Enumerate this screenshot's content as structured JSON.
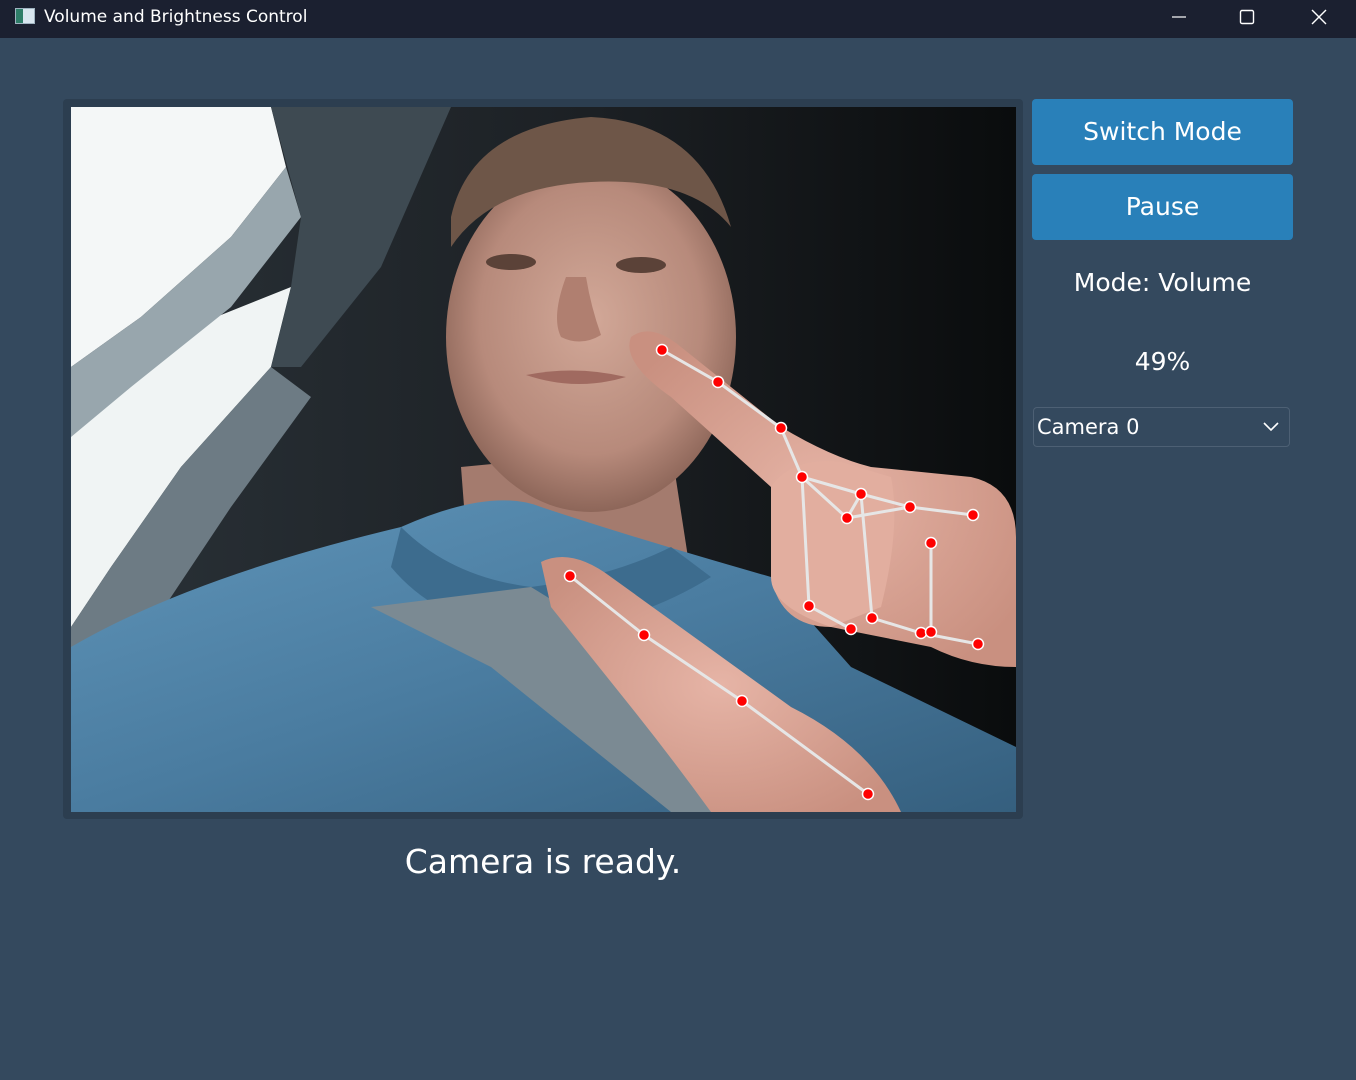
{
  "window": {
    "title": "Volume and Brightness Control",
    "controls": {
      "minimize": "minimize-icon",
      "maximize": "maximize-icon",
      "close": "close-icon"
    }
  },
  "controls": {
    "switch_mode_label": "Switch Mode",
    "pause_label": "Pause",
    "mode_text": "Mode: Volume",
    "value_text": "49%",
    "camera_select": {
      "selected": "Camera 0",
      "icon": "chevron-down-icon"
    }
  },
  "status": {
    "text": "Camera is ready."
  },
  "colors": {
    "background": "#34495e",
    "titlebar": "#1b2030",
    "button": "#2980b9",
    "landmark_point": "#ff0000",
    "landmark_line": "#e6e6e6"
  }
}
